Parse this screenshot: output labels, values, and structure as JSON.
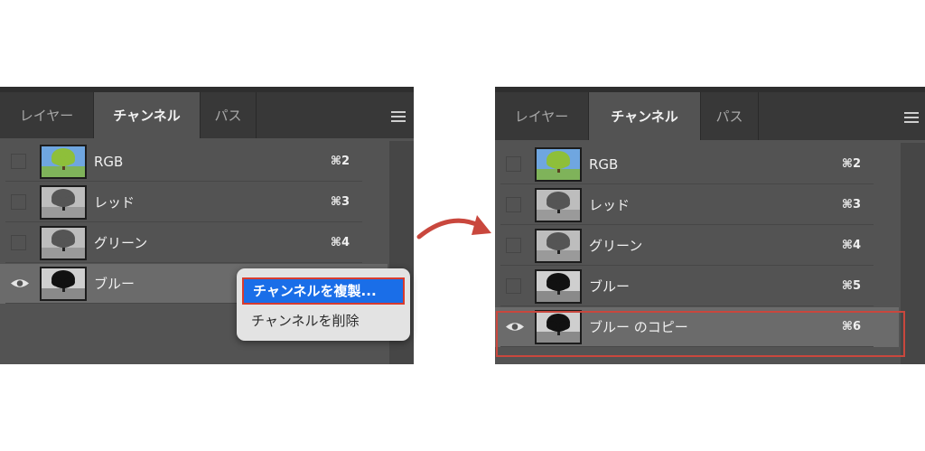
{
  "tabs": [
    "レイヤー",
    "チャンネル",
    "パス"
  ],
  "active_tab": "チャンネル",
  "left_panel": {
    "channels": [
      {
        "name": "RGB",
        "shortcut": "⌘2",
        "visible": false,
        "thumb": "color"
      },
      {
        "name": "レッド",
        "shortcut": "⌘3",
        "visible": false,
        "thumb": "gray"
      },
      {
        "name": "グリーン",
        "shortcut": "⌘4",
        "visible": false,
        "thumb": "gray"
      },
      {
        "name": "ブルー",
        "shortcut": "",
        "visible": true,
        "thumb": "dark",
        "selected": true
      }
    ],
    "context_menu": {
      "items": [
        "チャンネルを複製...",
        "チャンネルを削除"
      ]
    }
  },
  "right_panel": {
    "channels": [
      {
        "name": "RGB",
        "shortcut": "⌘2",
        "visible": false,
        "thumb": "color"
      },
      {
        "name": "レッド",
        "shortcut": "⌘3",
        "visible": false,
        "thumb": "gray"
      },
      {
        "name": "グリーン",
        "shortcut": "⌘4",
        "visible": false,
        "thumb": "gray"
      },
      {
        "name": "ブルー",
        "shortcut": "⌘5",
        "visible": false,
        "thumb": "dark"
      },
      {
        "name": "ブルー のコピー",
        "shortcut": "⌘6",
        "visible": true,
        "thumb": "dark",
        "selected": true
      }
    ]
  },
  "colors": {
    "panel": "#535353",
    "tabbar": "#383838",
    "accent": "#1a6ee8",
    "highlight_border": "#c9473d",
    "arrow": "#c9473d"
  },
  "icons": [
    "eye-icon",
    "panel-menu-icon",
    "arrow-right-icon"
  ]
}
